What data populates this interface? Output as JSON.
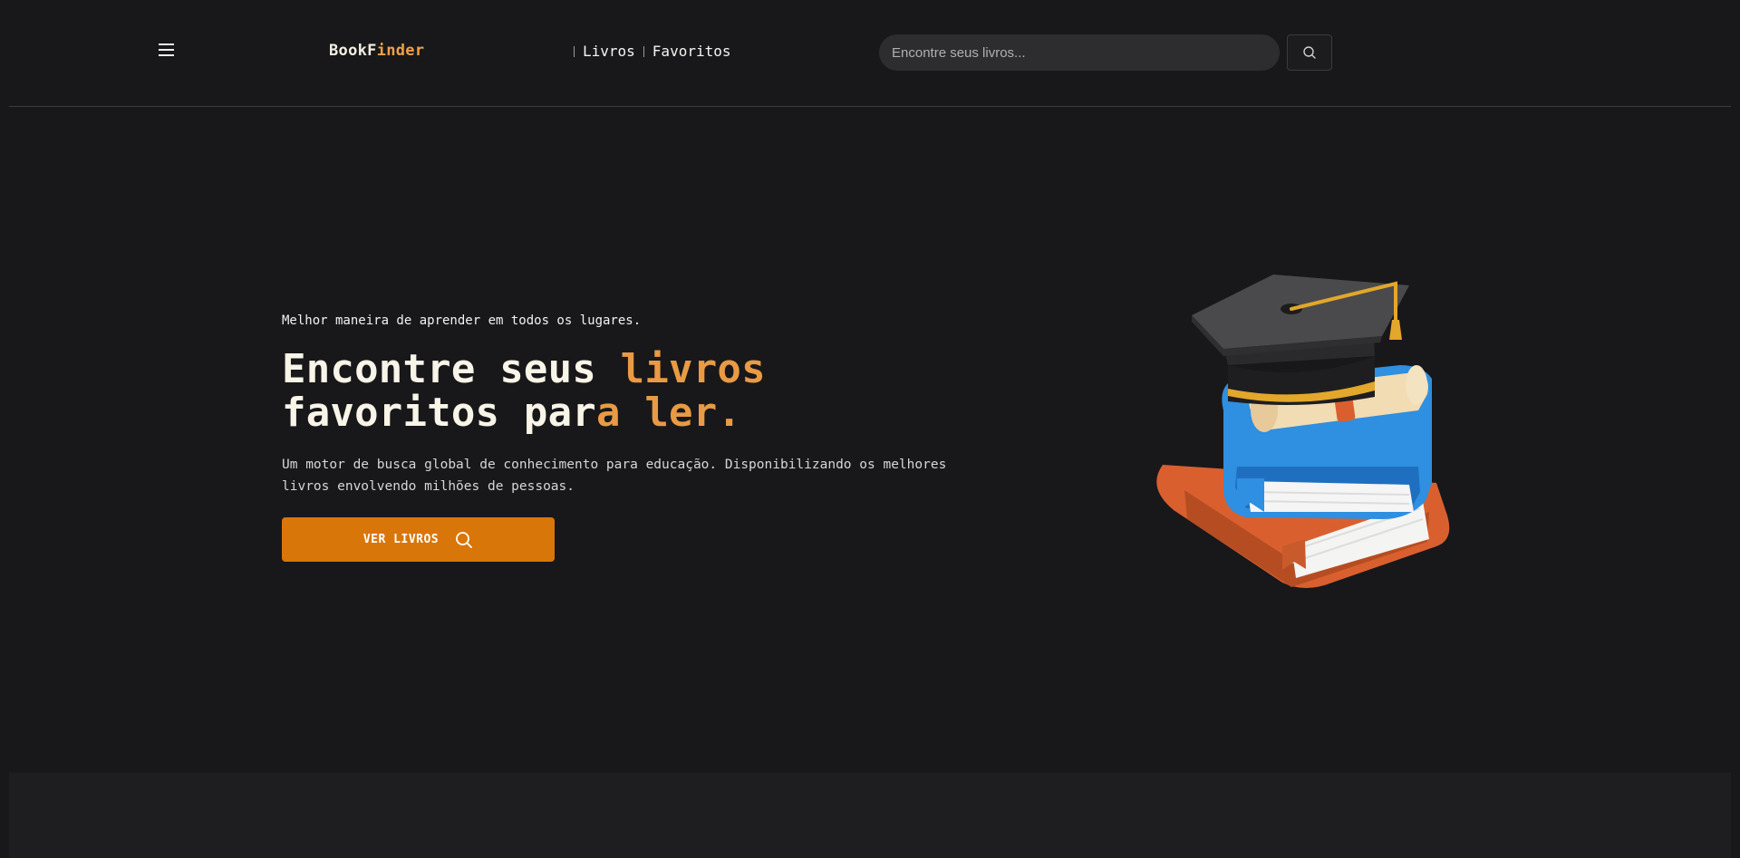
{
  "header": {
    "menu_icon": "hamburger-menu-icon",
    "logo_part1": "BookF",
    "logo_part2": "inder",
    "nav": [
      {
        "label": "Livros"
      },
      {
        "label": "Favoritos"
      }
    ],
    "search_placeholder": "Encontre seus livros...",
    "search_icon": "search-icon"
  },
  "hero": {
    "tagline": "Melhor maneira de aprender em todos os lugares.",
    "title_line1_plain": "Encontre seus ",
    "title_line1_accent": "livros",
    "title_line2_plain": "favoritos par",
    "title_line2_accent": "a ler.",
    "description": "Um motor de busca global de conhecimento para educação. Disponibilizando os melhores livros envolvendo milhões de pessoas.",
    "cta_label": "VER LIVROS",
    "cta_icon": "search-icon",
    "illustration": "graduation-cap-books-illustration"
  },
  "colors": {
    "background": "#18181a",
    "accent": "#e99a44",
    "button": "#d9760a"
  }
}
